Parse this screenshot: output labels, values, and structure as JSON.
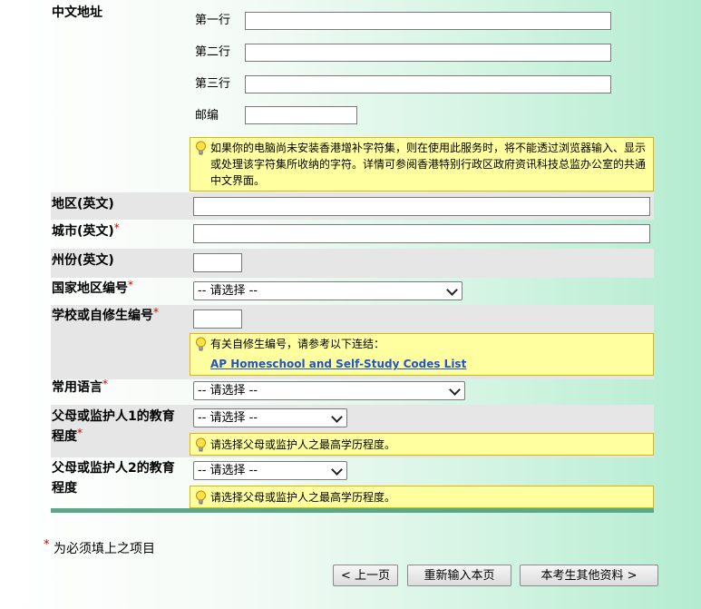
{
  "address_chinese": {
    "label": "中文地址",
    "lines": [
      {
        "label": "第一行",
        "value": ""
      },
      {
        "label": "第二行",
        "value": ""
      },
      {
        "label": "第三行",
        "value": ""
      }
    ],
    "postcode_label": "邮编",
    "postcode_value": "",
    "tip": "如果你的电脑尚未安装香港增补字符集，则在使用此服务时，将不能透过浏览器输入、显示或处理该字符集所收纳的字符。详情可参阅香港特别行政区政府资讯科技总监办公室的共通中文界面。"
  },
  "region_en": {
    "label": "地区(英文)",
    "value": ""
  },
  "city_en": {
    "label": "城市(英文)",
    "required": "*",
    "value": ""
  },
  "state_en": {
    "label": "州份(英文)",
    "value": ""
  },
  "country_code": {
    "label": "国家地区编号",
    "required": "*",
    "selected": "-- 请选择 --"
  },
  "school_code": {
    "label": "学校或自修生编号",
    "required": "*",
    "value": "",
    "tip": "有关自修生编号，请参考以下连结：",
    "link": "AP Homeschool and Self-Study Codes List"
  },
  "language": {
    "label": "常用语言",
    "required": "*",
    "selected": "-- 请选择 --"
  },
  "guardian1_edu": {
    "label_line1": "父母或监护人1的教育",
    "label_line2": "程度",
    "required": "*",
    "selected": "-- 请选择 --",
    "tip": "请选择父母或监护人之最高学历程度。"
  },
  "guardian2_edu": {
    "label_line1": "父母或监护人2的教育",
    "label_line2": "程度",
    "selected": "-- 请选择 --",
    "tip": "请选择父母或监护人之最高学历程度。"
  },
  "required_note": {
    "star": "*",
    "text": "为必须填上之项目"
  },
  "buttons": {
    "prev": "< 上一页",
    "reset": "重新输入本页",
    "next": "本考生其他资料 >"
  }
}
